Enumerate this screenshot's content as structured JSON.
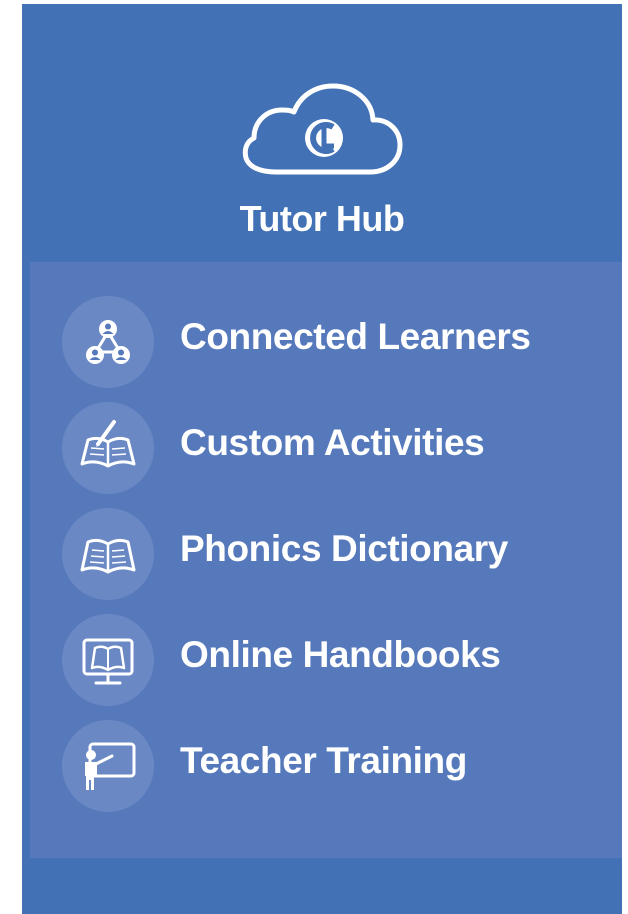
{
  "brand": {
    "name": "Tutor Hub",
    "logo_letter": "CL"
  },
  "menu": {
    "items": [
      {
        "id": "connected-learners",
        "label": "Connected Learners",
        "icon": "people-network-icon"
      },
      {
        "id": "custom-activities",
        "label": "Custom Activities",
        "icon": "book-pencil-icon"
      },
      {
        "id": "phonics-dictionary",
        "label": "Phonics Dictionary",
        "icon": "open-book-icon"
      },
      {
        "id": "online-handbooks",
        "label": "Online Handbooks",
        "icon": "monitor-book-icon"
      },
      {
        "id": "teacher-training",
        "label": "Teacher Training",
        "icon": "teacher-board-icon"
      }
    ]
  },
  "colors": {
    "panel": "#4271b5",
    "menu_background": "#5679bc",
    "text": "#ffffff"
  }
}
